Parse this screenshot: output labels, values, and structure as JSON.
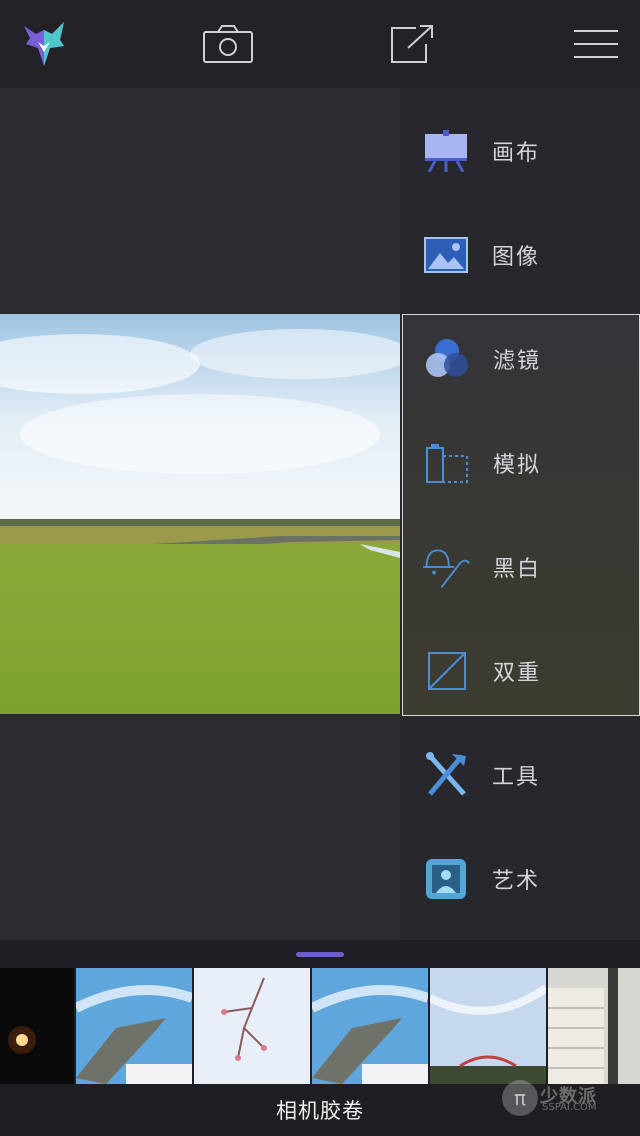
{
  "app": {
    "accent": "#6a60c8",
    "icon_color": "#4a8fd6"
  },
  "toolbar": {
    "logo_icon": "fox-logo-icon",
    "camera_icon": "camera-icon",
    "share_icon": "share-icon",
    "menu_icon": "hamburger-menu-icon"
  },
  "side_menu": {
    "top_items": [
      {
        "label": "画布",
        "icon": "easel-icon"
      },
      {
        "label": "图像",
        "icon": "image-icon"
      }
    ],
    "filter_items": [
      {
        "label": "滤镜",
        "icon": "filter-circles-icon"
      },
      {
        "label": "模拟",
        "icon": "film-roll-icon"
      },
      {
        "label": "黑白",
        "icon": "hat-cane-icon"
      },
      {
        "label": "双重",
        "icon": "double-exposure-icon"
      }
    ],
    "bottom_items": [
      {
        "label": "工具",
        "icon": "tools-icon"
      },
      {
        "label": "艺术",
        "icon": "art-stamp-icon"
      }
    ]
  },
  "camera_roll": {
    "label": "相机胶卷",
    "thumbnails": [
      "night-light-photo",
      "fighter-jet-photo",
      "blossom-branch-photo",
      "fighter-jet-photo",
      "stadium-sky-photo",
      "paper-stack-photo"
    ]
  },
  "watermark": {
    "brand": "少数派",
    "url": "SSPAI.COM"
  }
}
